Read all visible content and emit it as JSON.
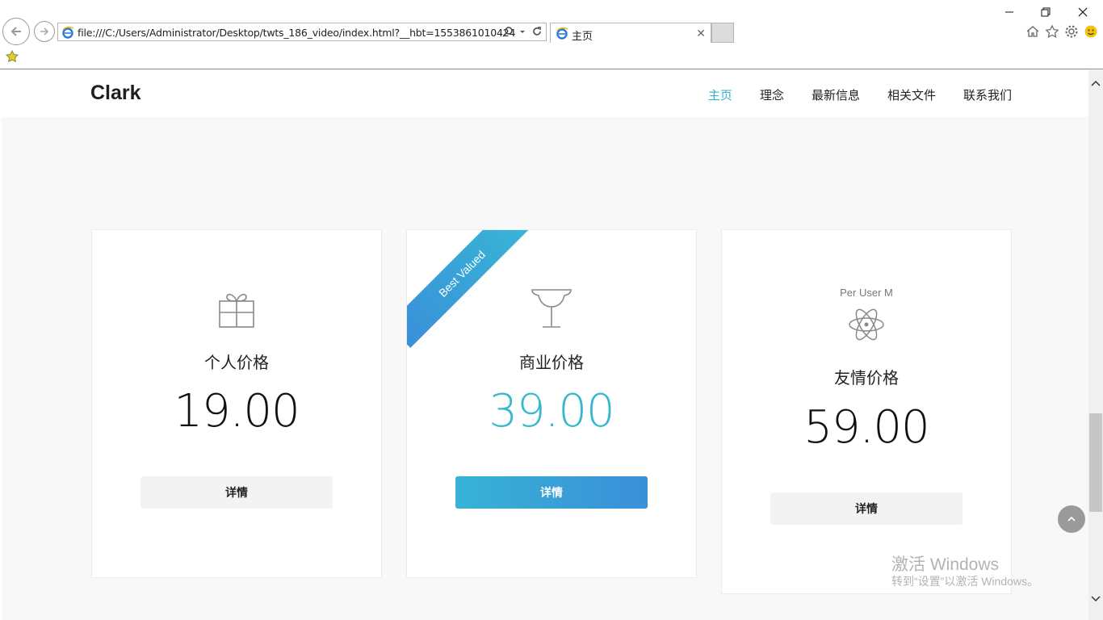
{
  "browser": {
    "url": "file:///C:/Users/Administrator/Desktop/twts_186_video/index.html?__hbt=1553861010424",
    "tab_title": "主页"
  },
  "site": {
    "brand": "Clark",
    "menu": [
      "主页",
      "理念",
      "最新信息",
      "相关文件",
      "联系我们"
    ]
  },
  "pricing": {
    "ribbon_label": "Best Valued",
    "cards": [
      {
        "title": "个人价格",
        "price": "19.00",
        "button": "详情",
        "icon": "gift-icon"
      },
      {
        "title": "商业价格",
        "price": "39.00",
        "button": "详情",
        "icon": "trophy-icon"
      },
      {
        "subtitle": "Per User M",
        "title": "友情价格",
        "price": "59.00",
        "button": "详情",
        "icon": "atom-icon"
      }
    ]
  },
  "watermark": {
    "line1": "激活 Windows",
    "line2": "转到“设置”以激活 Windows。"
  },
  "colors": {
    "accent": "#35b2d1",
    "button_gradient_start": "#37b3d6",
    "button_gradient_end": "#3a8fd9"
  }
}
